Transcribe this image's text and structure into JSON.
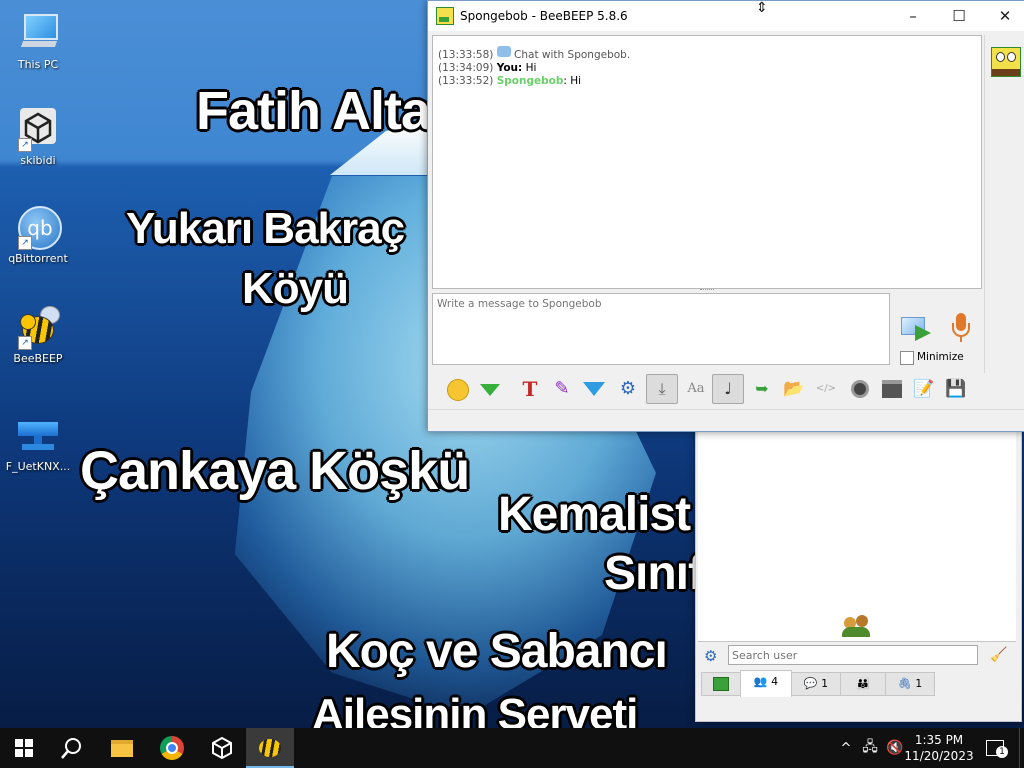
{
  "desktop": {
    "icons": [
      {
        "label": "This PC",
        "icon": "monitor-icon"
      },
      {
        "label": "skibidi",
        "icon": "unity-cube-icon"
      },
      {
        "label": "qBittorrent",
        "icon": "qbittorrent-icon"
      },
      {
        "label": "BeeBEEP",
        "icon": "bee-icon"
      },
      {
        "label": "F_UetKNX...",
        "icon": "network-switch-icon"
      }
    ],
    "wallpaper_texts": [
      "Fatih Alta",
      "Yukarı Bakraç",
      "Köyü",
      "Çankaya Köşkü",
      "Kemalist Z",
      "Sınıf",
      "Koç ve Sabancı",
      "Ailesinin Serveti"
    ]
  },
  "chat_window": {
    "title": "Spongebob - BeeBEEP 5.8.6",
    "controls": {
      "minimize": "–",
      "maximize": "☐",
      "close": "✕"
    },
    "messages": [
      {
        "time": "(13:33:58)",
        "sender": "",
        "text": "Chat with Spongebob."
      },
      {
        "time": "(13:34:09)",
        "sender": "You:",
        "text": "Hi"
      },
      {
        "time": "(13:33:52)",
        "sender": "Spongebob",
        "text": ": Hi"
      }
    ],
    "input_placeholder": "Write a message to Spongebob",
    "minimize_label": "Minimize",
    "toolbar_icons": [
      "emoticon-icon",
      "gem-icon",
      "text-style-icon",
      "color-picker-icon",
      "filter-icon",
      "settings-cogs-icon",
      "save-chat-icon",
      "font-icon",
      "sound-icon",
      "send-file-icon",
      "send-folder-icon",
      "html-code-icon",
      "screenshot-icon",
      "terminal-icon",
      "notes-icon",
      "floppy-save-icon"
    ],
    "accent_color": "#6ad06a"
  },
  "main_window": {
    "search_placeholder": "Search user",
    "tabs": [
      {
        "icon": "beebeep-icon",
        "count": ""
      },
      {
        "icon": "users-icon",
        "count": "4"
      },
      {
        "icon": "chat-bubbles-icon",
        "count": "1"
      },
      {
        "icon": "groups-icon",
        "count": ""
      },
      {
        "icon": "share-icon",
        "count": "1"
      }
    ]
  },
  "taskbar": {
    "apps": [
      "windows-start-icon",
      "search-icon",
      "file-explorer-icon",
      "chrome-icon",
      "unity-icon",
      "beebeep-icon"
    ],
    "time": "1:35 PM",
    "date": "11/20/2023",
    "notification_count": "1"
  }
}
